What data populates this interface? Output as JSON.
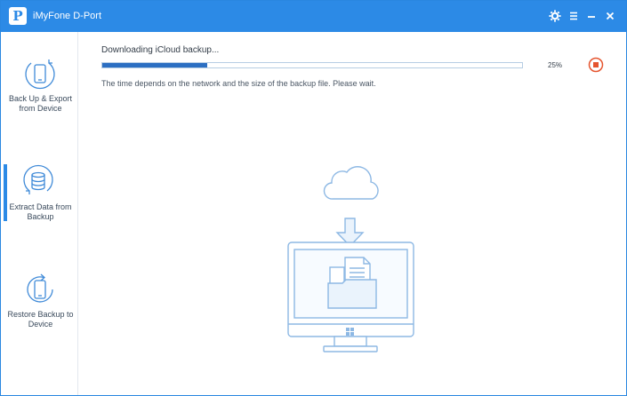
{
  "window": {
    "app_title": "iMyFone D-Port",
    "logo_letter": "P",
    "title_icons": [
      "gear-icon",
      "menu-icon",
      "minimize-icon",
      "close-icon"
    ]
  },
  "sidebar": {
    "items": [
      {
        "label": "Back Up & Export from Device",
        "icon": "phone-backup-icon",
        "active": false
      },
      {
        "label": "Extract Data from Backup",
        "icon": "database-icon",
        "active": true
      },
      {
        "label": "Restore Backup to Device",
        "icon": "phone-restore-icon",
        "active": false
      }
    ]
  },
  "download": {
    "status": "Downloading iCloud backup...",
    "progress_percent": 25,
    "progress_label": "25%",
    "hint": "The time depends on the network and the size of the backup file. Please wait."
  },
  "colors": {
    "accent": "#2c8ae6",
    "progress_fill": "#2c6fc2",
    "stop": "#e5542e",
    "illustration_line": "#8db8e4",
    "illustration_fill": "#eaf3fc"
  }
}
